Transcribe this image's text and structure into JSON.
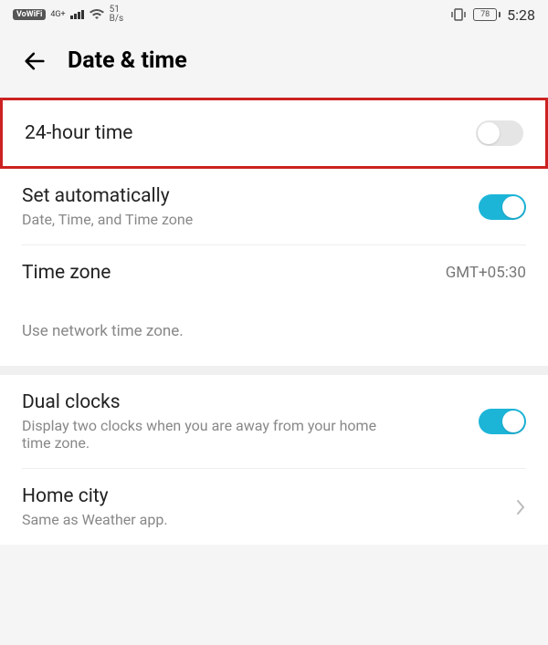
{
  "statusbar": {
    "vowifi": "VoWiFi",
    "net_top": "4G+",
    "net_bottom": "",
    "data_rate_num": "51",
    "data_rate_unit": "B/s",
    "battery": "78",
    "time": "5:28"
  },
  "header": {
    "title": "Date & time"
  },
  "settings": {
    "twentyfour": {
      "title": "24-hour time",
      "enabled": false
    },
    "auto": {
      "title": "Set automatically",
      "subtitle": "Date, Time, and Time zone",
      "enabled": true
    },
    "timezone": {
      "title": "Time zone",
      "value": "GMT+05:30"
    },
    "timezone_info": "Use network time zone.",
    "dual_clocks": {
      "title": "Dual clocks",
      "subtitle": "Display two clocks when you are away from your home time zone.",
      "enabled": true
    },
    "home_city": {
      "title": "Home city",
      "subtitle": "Same as Weather app."
    }
  }
}
